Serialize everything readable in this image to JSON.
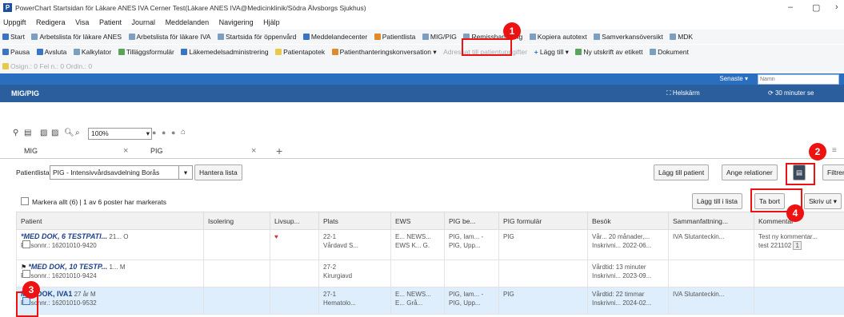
{
  "window": {
    "title": "PowerChart Startsidan för Läkare ANES IVA Cerner Test(Läkare ANES IVA@Medicinklinik/Södra Älvsborgs Sjukhus)",
    "minimize": "–",
    "restore": "▢",
    "close": "›"
  },
  "menu": [
    "Uppgift",
    "Redigera",
    "Visa",
    "Patient",
    "Journal",
    "Meddelanden",
    "Navigering",
    "Hjälp"
  ],
  "toolbar1": [
    "Start",
    "Arbetslista för läkare ANES",
    "Arbetslista för läkare IVA",
    "Startsida för öppenvård",
    "Meddelandecenter",
    "Patientlista",
    "MIG/PIG",
    "Remisshantering",
    "Kopiera autotext",
    "Samverkansöversikt",
    "MDK"
  ],
  "toolbar2": [
    "Pausa",
    "Avsluta",
    "Kalkylator",
    "Tilläggsformulär",
    "Läkemedelsadministrering",
    "Patientapotek",
    "Patienthanteringskonversation",
    "Adressat till patientuppgifter",
    "Lägg till",
    "Ny utskrift av etikett",
    "Dokument"
  ],
  "toolbar3": "Osign.: 0  Fel n.: 0  Ordin.: 0",
  "topband": {
    "recent": "Senaste",
    "search_placeholder": "Namn"
  },
  "header": {
    "title": "MIG/PIG",
    "fullscreen": "Helskärm",
    "refresh": "30 minuter se"
  },
  "zoom": "100%",
  "tabs": [
    {
      "label": "MIG"
    },
    {
      "label": "PIG"
    }
  ],
  "patient_list": {
    "label": "Patientlista",
    "selected": "PIG - Intensivvårdsavdelning Borås",
    "manage_button": "Hantera lista",
    "add_patient": "Lägg till patient",
    "set_relations": "Ange relationer",
    "filter": "Filtrera"
  },
  "mark_row": {
    "text": "Markera allt (6) | 1 av 6 poster har markerats",
    "add_to_list": "Lägg till i lista",
    "remove": "Ta bort",
    "print": "Skriv ut"
  },
  "columns": [
    "Patient",
    "Isolering",
    "Livsup...",
    "Plats",
    "EWS",
    "PIG be...",
    "PIG formulär",
    "Besök",
    "Sammanfattning...",
    "Kommentar"
  ],
  "rows": [
    {
      "name": "*MED DOK, 6 TESTPATI...",
      "age": "21...",
      "sex": "O",
      "pnr": "Personnr.: 16201010-9420",
      "isolering": "",
      "livsup": "♥",
      "plats1": "22-1",
      "plats2": "Vårdavd S...",
      "ews1": "E... NEWS...",
      "ews2": "EWS K... G.",
      "pig1": "PIG, Iam... -",
      "pig2": "PIG, Upp...",
      "form": "PIG",
      "besok1": "Vår... 20 månader,...",
      "besok2": "Inskrivni... 2022-06...",
      "samm": "IVA Slutanteckin...",
      "komm1": "Test ny kommentar...",
      "komm2": "test 221102",
      "count": "1"
    },
    {
      "name": "*MED DOK, 10 TESTP...",
      "age": "1...",
      "sex": "M",
      "pnr": "Personnr.: 16201010-9424",
      "isolering": "",
      "livsup": "",
      "plats1": "27-2",
      "plats2": "Kirurgiavd",
      "ews1": "",
      "ews2": "",
      "pig1": "",
      "pig2": "",
      "form": "",
      "besok1": "Vårdtid: 13 minuter",
      "besok2": "Inskrivni... 2023-09...",
      "samm": "",
      "komm1": "",
      "komm2": "",
      "count": ""
    },
    {
      "name": "MEDDOK, IVA1",
      "age": "27 år",
      "sex": "M",
      "pnr": "Personnr.: 16201010-9532",
      "isolering": "",
      "livsup": "",
      "plats1": "27-1",
      "plats2": "Hematolo...",
      "ews1": "E... NEWS...",
      "ews2": "E... Grå...",
      "pig1": "PIG, Iam... -",
      "pig2": "PIG, Upp...",
      "form": "PIG",
      "besok1": "Vårdtid: 22 timmar",
      "besok2": "Inskrivni... 2024-02...",
      "samm": "IVA Slutanteckin...",
      "komm1": "",
      "komm2": "",
      "count": ""
    }
  ],
  "markers": [
    "1",
    "2",
    "3",
    "4"
  ],
  "colors": {
    "accent_red": "#e11111",
    "header_blue": "#2a5e9c",
    "band_blue": "#2a6fbf",
    "link_blue": "#1e3f8a"
  }
}
